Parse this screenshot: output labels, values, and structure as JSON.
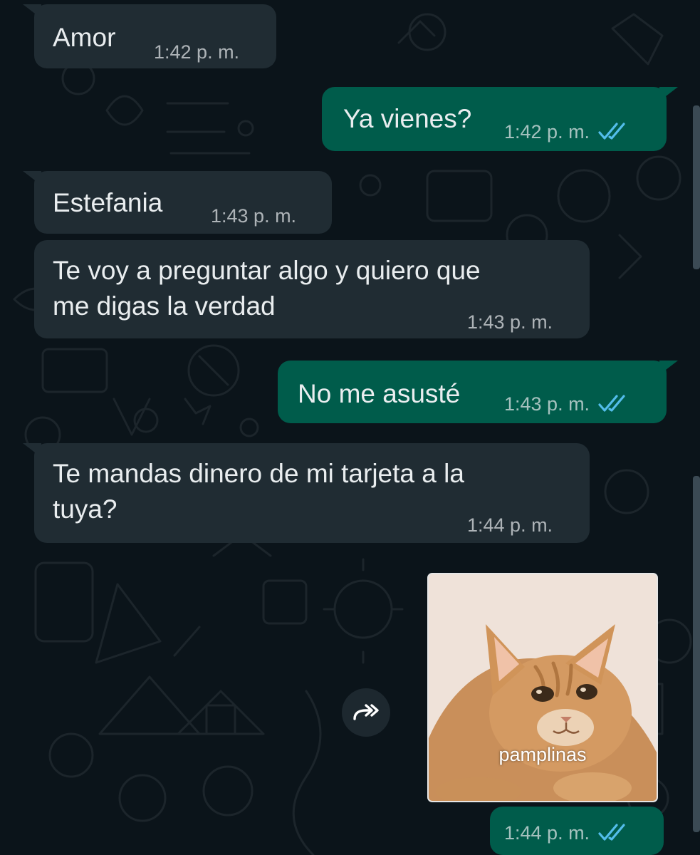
{
  "chat": {
    "messages": [
      {
        "direction": "incoming",
        "text": "Amor",
        "time": "1:42 p. m."
      },
      {
        "direction": "outgoing",
        "text": "Ya vienes?",
        "time": "1:42 p. m.",
        "status": "read"
      },
      {
        "direction": "incoming",
        "text": "Estefania",
        "time": "1:43 p. m."
      },
      {
        "direction": "incoming",
        "lines": [
          "Te voy a preguntar algo y quiero que",
          "me digas la verdad"
        ],
        "time": "1:43 p. m."
      },
      {
        "direction": "outgoing",
        "text": "No me asusté",
        "time": "1:43 p. m.",
        "status": "read"
      },
      {
        "direction": "incoming",
        "lines": [
          "Te mandas dinero de mi tarjeta a la",
          "tuya?"
        ],
        "time": "1:44 p. m."
      },
      {
        "direction": "outgoing",
        "type": "sticker",
        "sticker_caption": "pamplinas",
        "time": "1:44 p. m.",
        "status": "read"
      }
    ]
  },
  "icons": {
    "read_receipt": "double-check-icon",
    "forward": "forward-icon"
  },
  "colors": {
    "background": "#0b141a",
    "incoming_bubble": "#202c33",
    "outgoing_bubble": "#005c4b",
    "read_check": "#53bdeb"
  }
}
